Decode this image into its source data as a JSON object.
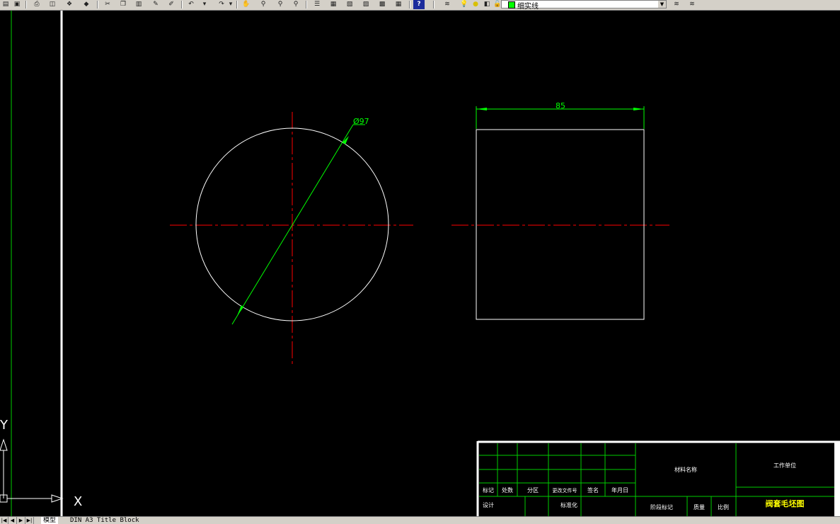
{
  "toolbar": {
    "icons": [
      "open-icon",
      "save-icon",
      "print-icon",
      "plot-preview-icon",
      "publish-icon",
      "3d-dwf-icon",
      "cut-icon",
      "copy-icon",
      "paste-icon",
      "match-properties-icon",
      "block-editor-icon",
      "undo-icon",
      "redo-icon",
      "pan-icon",
      "zoom-realtime-icon",
      "zoom-window-icon",
      "zoom-previous-icon",
      "properties-icon",
      "design-center-icon",
      "tool-palettes-icon",
      "sheet-set-icon",
      "markup-icon",
      "calculator-icon",
      "help-icon",
      "layer-manager-icon",
      "layer-state-icons"
    ],
    "layer": {
      "name": "细实线",
      "color": "#00ff00"
    }
  },
  "drawing": {
    "diameter_label": "Ø97",
    "width_label": "85"
  },
  "title_block": {
    "row_labels": [
      "标记",
      "处数",
      "分区",
      "更改文件号",
      "签名",
      "年月日"
    ],
    "designer_label": "设计",
    "standardize_label": "标准化",
    "material_label": "材料名称",
    "org_label": "工作单位",
    "stage_label": "阶段标记",
    "weight_label": "质量",
    "scale_label": "比例",
    "drawing_name": "阀套毛坯图"
  },
  "ucs": {
    "x_label": "X",
    "y_label": "Y"
  },
  "tabs": {
    "model": "模型",
    "layout": "DIN A3 Title Block"
  }
}
